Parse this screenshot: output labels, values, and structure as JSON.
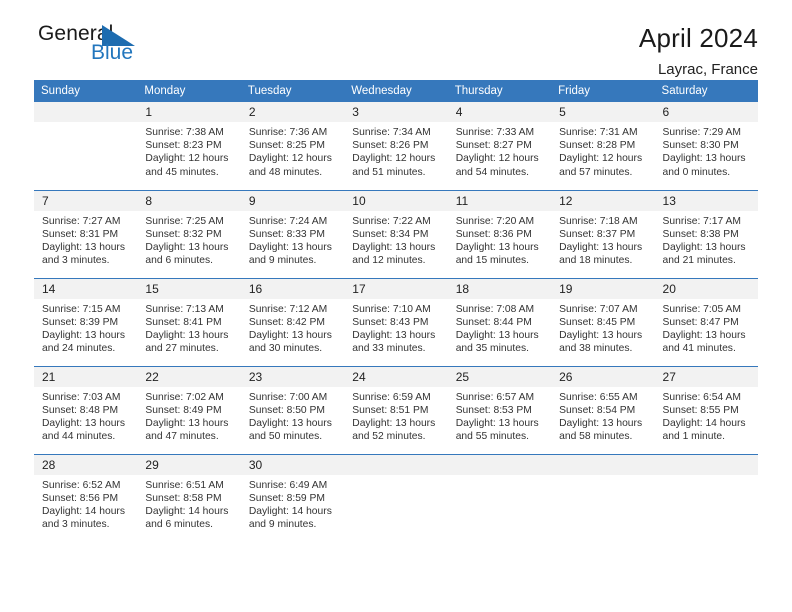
{
  "logo": {
    "word_one": "General",
    "word_two": "Blue",
    "triangle_color": "#1d6cb0",
    "blue_text_color": "#2276bd"
  },
  "header": {
    "title": "April 2024",
    "location": "Layrac, France"
  },
  "theme": {
    "header_blue": "#3678bc",
    "row_divider": "#3678bc",
    "daynum_band": "#f2f2f2"
  },
  "weekday_headers": [
    "Sunday",
    "Monday",
    "Tuesday",
    "Wednesday",
    "Thursday",
    "Friday",
    "Saturday"
  ],
  "weeks": [
    [
      {
        "day": "",
        "blank": true,
        "sunrise": "",
        "sunset": "",
        "daylight_1": "",
        "daylight_2": ""
      },
      {
        "day": "1",
        "sunrise": "Sunrise: 7:38 AM",
        "sunset": "Sunset: 8:23 PM",
        "daylight_1": "Daylight: 12 hours",
        "daylight_2": "and 45 minutes."
      },
      {
        "day": "2",
        "sunrise": "Sunrise: 7:36 AM",
        "sunset": "Sunset: 8:25 PM",
        "daylight_1": "Daylight: 12 hours",
        "daylight_2": "and 48 minutes."
      },
      {
        "day": "3",
        "sunrise": "Sunrise: 7:34 AM",
        "sunset": "Sunset: 8:26 PM",
        "daylight_1": "Daylight: 12 hours",
        "daylight_2": "and 51 minutes."
      },
      {
        "day": "4",
        "sunrise": "Sunrise: 7:33 AM",
        "sunset": "Sunset: 8:27 PM",
        "daylight_1": "Daylight: 12 hours",
        "daylight_2": "and 54 minutes."
      },
      {
        "day": "5",
        "sunrise": "Sunrise: 7:31 AM",
        "sunset": "Sunset: 8:28 PM",
        "daylight_1": "Daylight: 12 hours",
        "daylight_2": "and 57 minutes."
      },
      {
        "day": "6",
        "sunrise": "Sunrise: 7:29 AM",
        "sunset": "Sunset: 8:30 PM",
        "daylight_1": "Daylight: 13 hours",
        "daylight_2": "and 0 minutes."
      }
    ],
    [
      {
        "day": "7",
        "sunrise": "Sunrise: 7:27 AM",
        "sunset": "Sunset: 8:31 PM",
        "daylight_1": "Daylight: 13 hours",
        "daylight_2": "and 3 minutes."
      },
      {
        "day": "8",
        "sunrise": "Sunrise: 7:25 AM",
        "sunset": "Sunset: 8:32 PM",
        "daylight_1": "Daylight: 13 hours",
        "daylight_2": "and 6 minutes."
      },
      {
        "day": "9",
        "sunrise": "Sunrise: 7:24 AM",
        "sunset": "Sunset: 8:33 PM",
        "daylight_1": "Daylight: 13 hours",
        "daylight_2": "and 9 minutes."
      },
      {
        "day": "10",
        "sunrise": "Sunrise: 7:22 AM",
        "sunset": "Sunset: 8:34 PM",
        "daylight_1": "Daylight: 13 hours",
        "daylight_2": "and 12 minutes."
      },
      {
        "day": "11",
        "sunrise": "Sunrise: 7:20 AM",
        "sunset": "Sunset: 8:36 PM",
        "daylight_1": "Daylight: 13 hours",
        "daylight_2": "and 15 minutes."
      },
      {
        "day": "12",
        "sunrise": "Sunrise: 7:18 AM",
        "sunset": "Sunset: 8:37 PM",
        "daylight_1": "Daylight: 13 hours",
        "daylight_2": "and 18 minutes."
      },
      {
        "day": "13",
        "sunrise": "Sunrise: 7:17 AM",
        "sunset": "Sunset: 8:38 PM",
        "daylight_1": "Daylight: 13 hours",
        "daylight_2": "and 21 minutes."
      }
    ],
    [
      {
        "day": "14",
        "sunrise": "Sunrise: 7:15 AM",
        "sunset": "Sunset: 8:39 PM",
        "daylight_1": "Daylight: 13 hours",
        "daylight_2": "and 24 minutes."
      },
      {
        "day": "15",
        "sunrise": "Sunrise: 7:13 AM",
        "sunset": "Sunset: 8:41 PM",
        "daylight_1": "Daylight: 13 hours",
        "daylight_2": "and 27 minutes."
      },
      {
        "day": "16",
        "sunrise": "Sunrise: 7:12 AM",
        "sunset": "Sunset: 8:42 PM",
        "daylight_1": "Daylight: 13 hours",
        "daylight_2": "and 30 minutes."
      },
      {
        "day": "17",
        "sunrise": "Sunrise: 7:10 AM",
        "sunset": "Sunset: 8:43 PM",
        "daylight_1": "Daylight: 13 hours",
        "daylight_2": "and 33 minutes."
      },
      {
        "day": "18",
        "sunrise": "Sunrise: 7:08 AM",
        "sunset": "Sunset: 8:44 PM",
        "daylight_1": "Daylight: 13 hours",
        "daylight_2": "and 35 minutes."
      },
      {
        "day": "19",
        "sunrise": "Sunrise: 7:07 AM",
        "sunset": "Sunset: 8:45 PM",
        "daylight_1": "Daylight: 13 hours",
        "daylight_2": "and 38 minutes."
      },
      {
        "day": "20",
        "sunrise": "Sunrise: 7:05 AM",
        "sunset": "Sunset: 8:47 PM",
        "daylight_1": "Daylight: 13 hours",
        "daylight_2": "and 41 minutes."
      }
    ],
    [
      {
        "day": "21",
        "sunrise": "Sunrise: 7:03 AM",
        "sunset": "Sunset: 8:48 PM",
        "daylight_1": "Daylight: 13 hours",
        "daylight_2": "and 44 minutes."
      },
      {
        "day": "22",
        "sunrise": "Sunrise: 7:02 AM",
        "sunset": "Sunset: 8:49 PM",
        "daylight_1": "Daylight: 13 hours",
        "daylight_2": "and 47 minutes."
      },
      {
        "day": "23",
        "sunrise": "Sunrise: 7:00 AM",
        "sunset": "Sunset: 8:50 PM",
        "daylight_1": "Daylight: 13 hours",
        "daylight_2": "and 50 minutes."
      },
      {
        "day": "24",
        "sunrise": "Sunrise: 6:59 AM",
        "sunset": "Sunset: 8:51 PM",
        "daylight_1": "Daylight: 13 hours",
        "daylight_2": "and 52 minutes."
      },
      {
        "day": "25",
        "sunrise": "Sunrise: 6:57 AM",
        "sunset": "Sunset: 8:53 PM",
        "daylight_1": "Daylight: 13 hours",
        "daylight_2": "and 55 minutes."
      },
      {
        "day": "26",
        "sunrise": "Sunrise: 6:55 AM",
        "sunset": "Sunset: 8:54 PM",
        "daylight_1": "Daylight: 13 hours",
        "daylight_2": "and 58 minutes."
      },
      {
        "day": "27",
        "sunrise": "Sunrise: 6:54 AM",
        "sunset": "Sunset: 8:55 PM",
        "daylight_1": "Daylight: 14 hours",
        "daylight_2": "and 1 minute."
      }
    ],
    [
      {
        "day": "28",
        "sunrise": "Sunrise: 6:52 AM",
        "sunset": "Sunset: 8:56 PM",
        "daylight_1": "Daylight: 14 hours",
        "daylight_2": "and 3 minutes."
      },
      {
        "day": "29",
        "sunrise": "Sunrise: 6:51 AM",
        "sunset": "Sunset: 8:58 PM",
        "daylight_1": "Daylight: 14 hours",
        "daylight_2": "and 6 minutes."
      },
      {
        "day": "30",
        "sunrise": "Sunrise: 6:49 AM",
        "sunset": "Sunset: 8:59 PM",
        "daylight_1": "Daylight: 14 hours",
        "daylight_2": "and 9 minutes."
      },
      {
        "day": "",
        "blank": true,
        "sunrise": "",
        "sunset": "",
        "daylight_1": "",
        "daylight_2": ""
      },
      {
        "day": "",
        "blank": true,
        "sunrise": "",
        "sunset": "",
        "daylight_1": "",
        "daylight_2": ""
      },
      {
        "day": "",
        "blank": true,
        "sunrise": "",
        "sunset": "",
        "daylight_1": "",
        "daylight_2": ""
      },
      {
        "day": "",
        "blank": true,
        "sunrise": "",
        "sunset": "",
        "daylight_1": "",
        "daylight_2": ""
      }
    ]
  ]
}
